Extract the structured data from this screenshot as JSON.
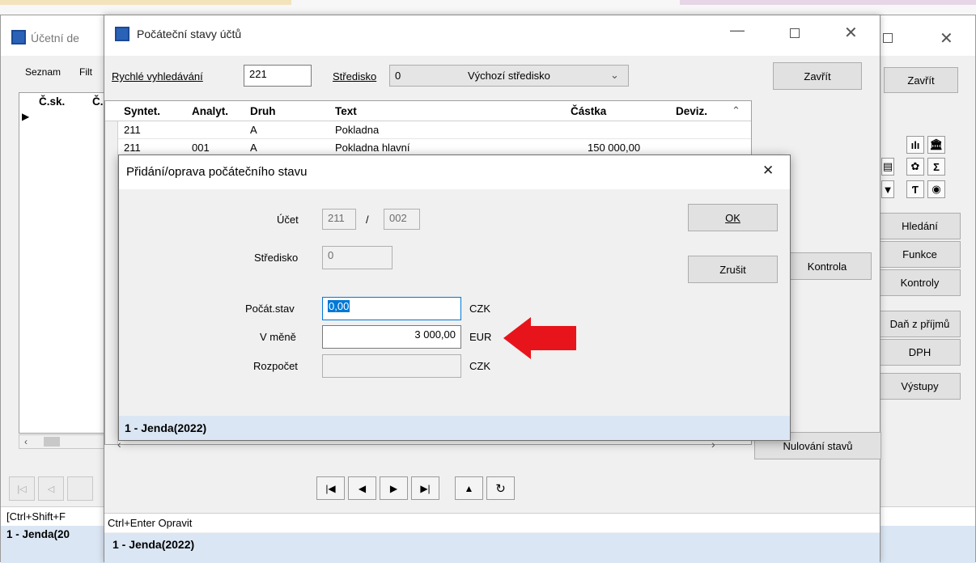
{
  "back_window": {
    "title": "Účetní de",
    "tabs": [
      "Seznam",
      "Filt"
    ],
    "columns": [
      "Č.sk.",
      "Č."
    ],
    "close_label": "Zavřít",
    "buttons": [
      "Hledání",
      "Funkce",
      "Kontroly",
      "Daň z příjmů",
      "DPH",
      "Výstupy"
    ],
    "shortcut_hint": "[Ctrl+Shift+F",
    "status": "1 - Jenda(20"
  },
  "main_window": {
    "title": "Počáteční stavy účtů",
    "quick_search_label": "Rychlé vyhledávání",
    "quick_search_value": "221",
    "center_label": "Středisko",
    "center_code": "0",
    "center_name": "Výchozí středisko",
    "close_label": "Zavřít",
    "kontrola_label": "Kontrola",
    "reset_label": "Nulování stavů",
    "grid": {
      "columns": [
        "Syntet.",
        "Analyt.",
        "Druh",
        "Text",
        "Částka",
        "Deviz."
      ],
      "rows": [
        {
          "syntet": "211",
          "analyt": "",
          "druh": "A",
          "text": "Pokladna",
          "castka": "",
          "deviz": ""
        },
        {
          "syntet": "211",
          "analyt": "001",
          "druh": "A",
          "text": "Pokladna hlavní",
          "castka": "150 000,00",
          "deviz": ""
        }
      ]
    },
    "shortcut_hint": "Ctrl+Enter Opravit",
    "status": "1 - Jenda(2022)"
  },
  "dialog": {
    "title": "Přidání/oprava počátečního stavu",
    "account_label": "Účet",
    "account_synt": "211",
    "account_sep": "/",
    "account_anal": "002",
    "center_label": "Středisko",
    "center_value": "0",
    "initial_label": "Počát.stav",
    "initial_value": "0,00",
    "initial_currency": "CZK",
    "foreign_label": "V měně",
    "foreign_value": "3 000,00",
    "foreign_currency": "EUR",
    "budget_label": "Rozpočet",
    "budget_value": "",
    "budget_currency": "CZK",
    "ok_label": "OK",
    "cancel_label": "Zrušit",
    "status": "1 - Jenda(2022)"
  },
  "colors": {
    "arrow": "#e8141b",
    "status_bar": "#dbe6f4",
    "selection": "#0078d7"
  }
}
